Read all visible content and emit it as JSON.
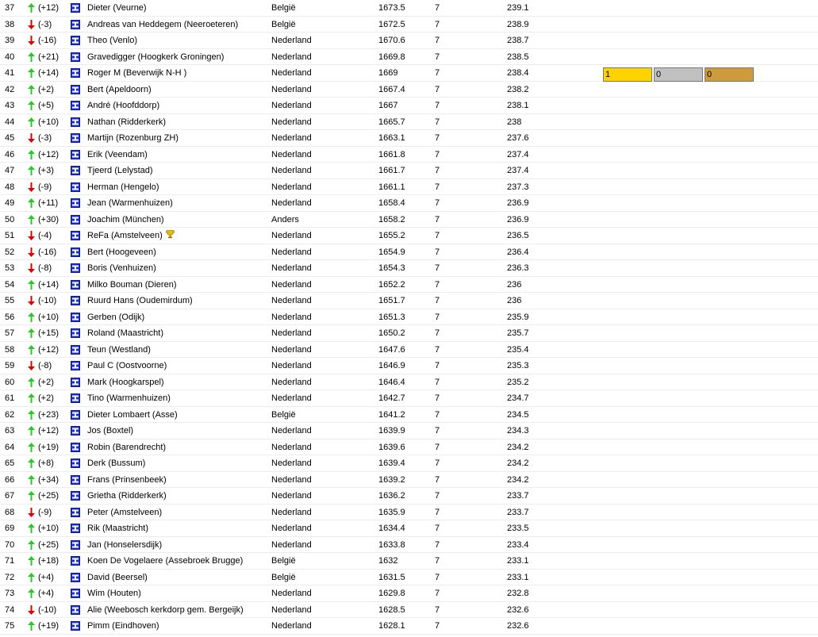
{
  "colors": {
    "up": "#22cc22",
    "down": "#dd0000",
    "gold": "#ffd200",
    "silver": "#c0c0c0",
    "bronze": "#cd9b3c",
    "flag_blue": "#1e2fd0"
  },
  "icons": {
    "trend_up": "arrow-up-icon",
    "trend_down": "arrow-down-icon",
    "flag": "player-flag-icon",
    "trophy": "trophy-icon"
  },
  "rows": [
    {
      "rank": "37",
      "dir": "up",
      "change": "(+12)",
      "name": "Dieter (Veurne)",
      "country": "België",
      "score": "1673.5",
      "games": "7",
      "avg": "239.1"
    },
    {
      "rank": "38",
      "dir": "down",
      "change": "(-3)",
      "name": "Andreas van Heddegem (Neeroeteren)",
      "country": "België",
      "score": "1672.5",
      "games": "7",
      "avg": "238.9"
    },
    {
      "rank": "39",
      "dir": "down",
      "change": "(-16)",
      "name": "Theo (Venlo)",
      "country": "Nederland",
      "score": "1670.6",
      "games": "7",
      "avg": "238.7"
    },
    {
      "rank": "40",
      "dir": "up",
      "change": "(+21)",
      "name": "Gravedigger (Hoogkerk Groningen)",
      "country": "Nederland",
      "score": "1669.8",
      "games": "7",
      "avg": "238.5"
    },
    {
      "rank": "41",
      "dir": "up",
      "change": "(+14)",
      "name": "Roger M (Beverwijk N-H )",
      "country": "Nederland",
      "score": "1669",
      "games": "7",
      "avg": "238.4",
      "medals": {
        "gold": "1",
        "silver": "0",
        "bronze": "0"
      }
    },
    {
      "rank": "42",
      "dir": "up",
      "change": "(+2)",
      "name": "Bert (Apeldoorn)",
      "country": "Nederland",
      "score": "1667.4",
      "games": "7",
      "avg": "238.2"
    },
    {
      "rank": "43",
      "dir": "up",
      "change": "(+5)",
      "name": "André (Hoofddorp)",
      "country": "Nederland",
      "score": "1667",
      "games": "7",
      "avg": "238.1"
    },
    {
      "rank": "44",
      "dir": "up",
      "change": "(+10)",
      "name": "Nathan (Ridderkerk)",
      "country": "Nederland",
      "score": "1665.7",
      "games": "7",
      "avg": "238"
    },
    {
      "rank": "45",
      "dir": "down",
      "change": "(-3)",
      "name": "Martijn (Rozenburg ZH)",
      "country": "Nederland",
      "score": "1663.1",
      "games": "7",
      "avg": "237.6"
    },
    {
      "rank": "46",
      "dir": "up",
      "change": "(+12)",
      "name": "Erik (Veendam)",
      "country": "Nederland",
      "score": "1661.8",
      "games": "7",
      "avg": "237.4"
    },
    {
      "rank": "47",
      "dir": "up",
      "change": "(+3)",
      "name": "Tjeerd (Lelystad)",
      "country": "Nederland",
      "score": "1661.7",
      "games": "7",
      "avg": "237.4"
    },
    {
      "rank": "48",
      "dir": "down",
      "change": "(-9)",
      "name": "Herman (Hengelo)",
      "country": "Nederland",
      "score": "1661.1",
      "games": "7",
      "avg": "237.3"
    },
    {
      "rank": "49",
      "dir": "up",
      "change": "(+11)",
      "name": "Jean (Warmenhuizen)",
      "country": "Nederland",
      "score": "1658.4",
      "games": "7",
      "avg": "236.9"
    },
    {
      "rank": "50",
      "dir": "up",
      "change": "(+30)",
      "name": "Joachim (München)",
      "country": "Anders",
      "score": "1658.2",
      "games": "7",
      "avg": "236.9"
    },
    {
      "rank": "51",
      "dir": "down",
      "change": "(-4)",
      "name": "ReFa (Amstelveen)",
      "country": "Nederland",
      "score": "1655.2",
      "games": "7",
      "avg": "236.5",
      "trophy": true
    },
    {
      "rank": "52",
      "dir": "down",
      "change": "(-16)",
      "name": "Bert (Hoogeveen)",
      "country": "Nederland",
      "score": "1654.9",
      "games": "7",
      "avg": "236.4"
    },
    {
      "rank": "53",
      "dir": "down",
      "change": "(-8)",
      "name": "Boris (Venhuizen)",
      "country": "Nederland",
      "score": "1654.3",
      "games": "7",
      "avg": "236.3"
    },
    {
      "rank": "54",
      "dir": "up",
      "change": "(+14)",
      "name": "Milko Bouman (Dieren)",
      "country": "Nederland",
      "score": "1652.2",
      "games": "7",
      "avg": "236"
    },
    {
      "rank": "55",
      "dir": "down",
      "change": "(-10)",
      "name": "Ruurd Hans (Oudemirdum)",
      "country": "Nederland",
      "score": "1651.7",
      "games": "7",
      "avg": "236"
    },
    {
      "rank": "56",
      "dir": "up",
      "change": "(+10)",
      "name": "Gerben (Odijk)",
      "country": "Nederland",
      "score": "1651.3",
      "games": "7",
      "avg": "235.9"
    },
    {
      "rank": "57",
      "dir": "up",
      "change": "(+15)",
      "name": "Roland (Maastricht)",
      "country": "Nederland",
      "score": "1650.2",
      "games": "7",
      "avg": "235.7"
    },
    {
      "rank": "58",
      "dir": "up",
      "change": "(+12)",
      "name": "Teun (Westland)",
      "country": "Nederland",
      "score": "1647.6",
      "games": "7",
      "avg": "235.4"
    },
    {
      "rank": "59",
      "dir": "down",
      "change": "(-8)",
      "name": "Paul C (Oostvoorne)",
      "country": "Nederland",
      "score": "1646.9",
      "games": "7",
      "avg": "235.3"
    },
    {
      "rank": "60",
      "dir": "up",
      "change": "(+2)",
      "name": "Mark (Hoogkarspel)",
      "country": "Nederland",
      "score": "1646.4",
      "games": "7",
      "avg": "235.2"
    },
    {
      "rank": "61",
      "dir": "up",
      "change": "(+2)",
      "name": "Tino (Warmenhuizen)",
      "country": "Nederland",
      "score": "1642.7",
      "games": "7",
      "avg": "234.7"
    },
    {
      "rank": "62",
      "dir": "up",
      "change": "(+23)",
      "name": "Dieter Lombaert (Asse)",
      "country": "België",
      "score": "1641.2",
      "games": "7",
      "avg": "234.5"
    },
    {
      "rank": "63",
      "dir": "up",
      "change": "(+12)",
      "name": "Jos (Boxtel)",
      "country": "Nederland",
      "score": "1639.9",
      "games": "7",
      "avg": "234.3"
    },
    {
      "rank": "64",
      "dir": "up",
      "change": "(+19)",
      "name": "Robin (Barendrecht)",
      "country": "Nederland",
      "score": "1639.6",
      "games": "7",
      "avg": "234.2"
    },
    {
      "rank": "65",
      "dir": "up",
      "change": "(+8)",
      "name": "Derk (Bussum)",
      "country": "Nederland",
      "score": "1639.4",
      "games": "7",
      "avg": "234.2"
    },
    {
      "rank": "66",
      "dir": "up",
      "change": "(+34)",
      "name": "Frans (Prinsenbeek)",
      "country": "Nederland",
      "score": "1639.2",
      "games": "7",
      "avg": "234.2"
    },
    {
      "rank": "67",
      "dir": "up",
      "change": "(+25)",
      "name": "Grietha (Ridderkerk)",
      "country": "Nederland",
      "score": "1636.2",
      "games": "7",
      "avg": "233.7"
    },
    {
      "rank": "68",
      "dir": "down",
      "change": "(-9)",
      "name": "Peter (Amstelveen)",
      "country": "Nederland",
      "score": "1635.9",
      "games": "7",
      "avg": "233.7"
    },
    {
      "rank": "69",
      "dir": "up",
      "change": "(+10)",
      "name": "Rik (Maastricht)",
      "country": "Nederland",
      "score": "1634.4",
      "games": "7",
      "avg": "233.5"
    },
    {
      "rank": "70",
      "dir": "up",
      "change": "(+25)",
      "name": "Jan (Honselersdijk)",
      "country": "Nederland",
      "score": "1633.8",
      "games": "7",
      "avg": "233.4"
    },
    {
      "rank": "71",
      "dir": "up",
      "change": "(+18)",
      "name": "Koen De Vogelaere (Assebroek Brugge)",
      "country": "België",
      "score": "1632",
      "games": "7",
      "avg": "233.1"
    },
    {
      "rank": "72",
      "dir": "up",
      "change": "(+4)",
      "name": "David (Beersel)",
      "country": "België",
      "score": "1631.5",
      "games": "7",
      "avg": "233.1"
    },
    {
      "rank": "73",
      "dir": "up",
      "change": "(+4)",
      "name": "Wim (Houten)",
      "country": "Nederland",
      "score": "1629.8",
      "games": "7",
      "avg": "232.8"
    },
    {
      "rank": "74",
      "dir": "down",
      "change": "(-10)",
      "name": "Alie (Weebosch kerkdorp gem. Bergeijk)",
      "country": "Nederland",
      "score": "1628.5",
      "games": "7",
      "avg": "232.6"
    },
    {
      "rank": "75",
      "dir": "up",
      "change": "(+19)",
      "name": "Pimm (Eindhoven)",
      "country": "Nederland",
      "score": "1628.1",
      "games": "7",
      "avg": "232.6"
    }
  ]
}
